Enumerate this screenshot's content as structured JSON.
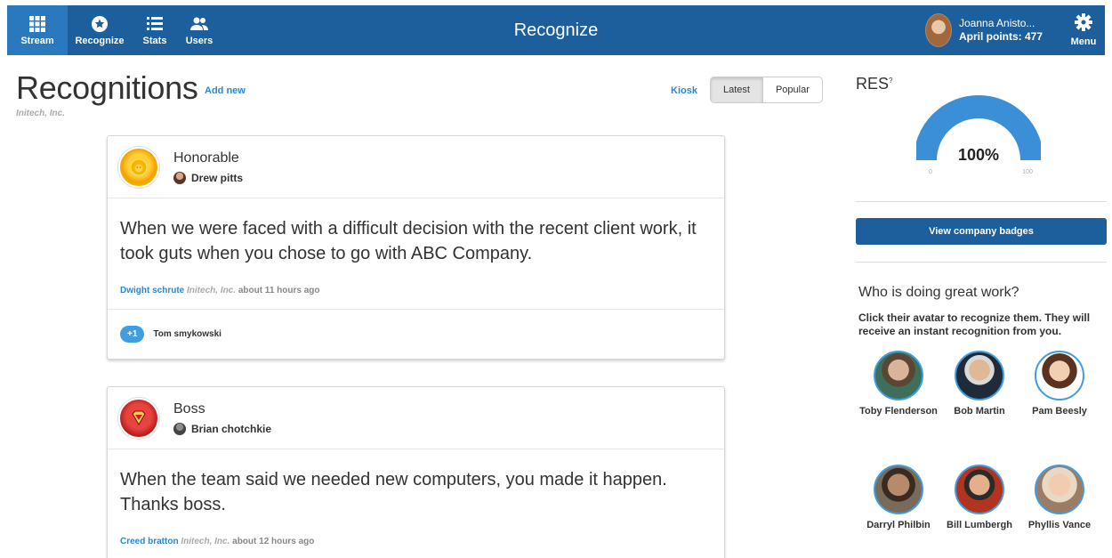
{
  "nav": {
    "stream_label": "Stream",
    "recognize_label": "Recognize",
    "stats_label": "Stats",
    "users_label": "Users",
    "title": "Recognize",
    "user_name": "Joanna Anisto...",
    "user_points": "April points: 477",
    "menu_label": "Menu",
    "accent": "#1c5f9c",
    "active_accent": "#2a79bf"
  },
  "header": {
    "title": "Recognitions",
    "add_new": "Add new",
    "company": "Initech, Inc.",
    "kiosk": "Kiosk",
    "tabs": [
      "Latest",
      "Popular"
    ],
    "active_tab": "Latest"
  },
  "recognitions": [
    {
      "badge": "Honorable",
      "badge_icon": "lion-icon",
      "recipient": "Drew pitts",
      "message": "When we were faced with a difficult decision with the recent client work, it took guts when you chose to go with ABC Company.",
      "sender": "Dwight schrute",
      "company": "Initech, Inc.",
      "time": "about 11 hours ago",
      "plus_one": "+1",
      "plus_one_by": "Tom smykowski"
    },
    {
      "badge": "Boss",
      "badge_icon": "superhero-shield-icon",
      "recipient": "Brian chotchkie",
      "message": "When the team said we needed new computers, you made it happen. Thanks boss.",
      "sender": "Creed bratton",
      "company": "Initech, Inc.",
      "time": "about 12 hours ago"
    }
  ],
  "sidebar": {
    "res_title": "RES",
    "res_sup": "?",
    "gauge_value": "100%",
    "gauge_fraction": 1.0,
    "gauge_min": "0",
    "gauge_max": "100",
    "badges_button": "View company badges",
    "who_title": "Who is doing great work?",
    "who_desc": "Click their avatar to recognize them. They will receive an instant recognition from you.",
    "people": [
      "Toby Flenderson",
      "Bob Martin",
      "Pam Beesly",
      "Darryl Philbin",
      "Bill Lumbergh",
      "Phyllis Vance"
    ]
  }
}
